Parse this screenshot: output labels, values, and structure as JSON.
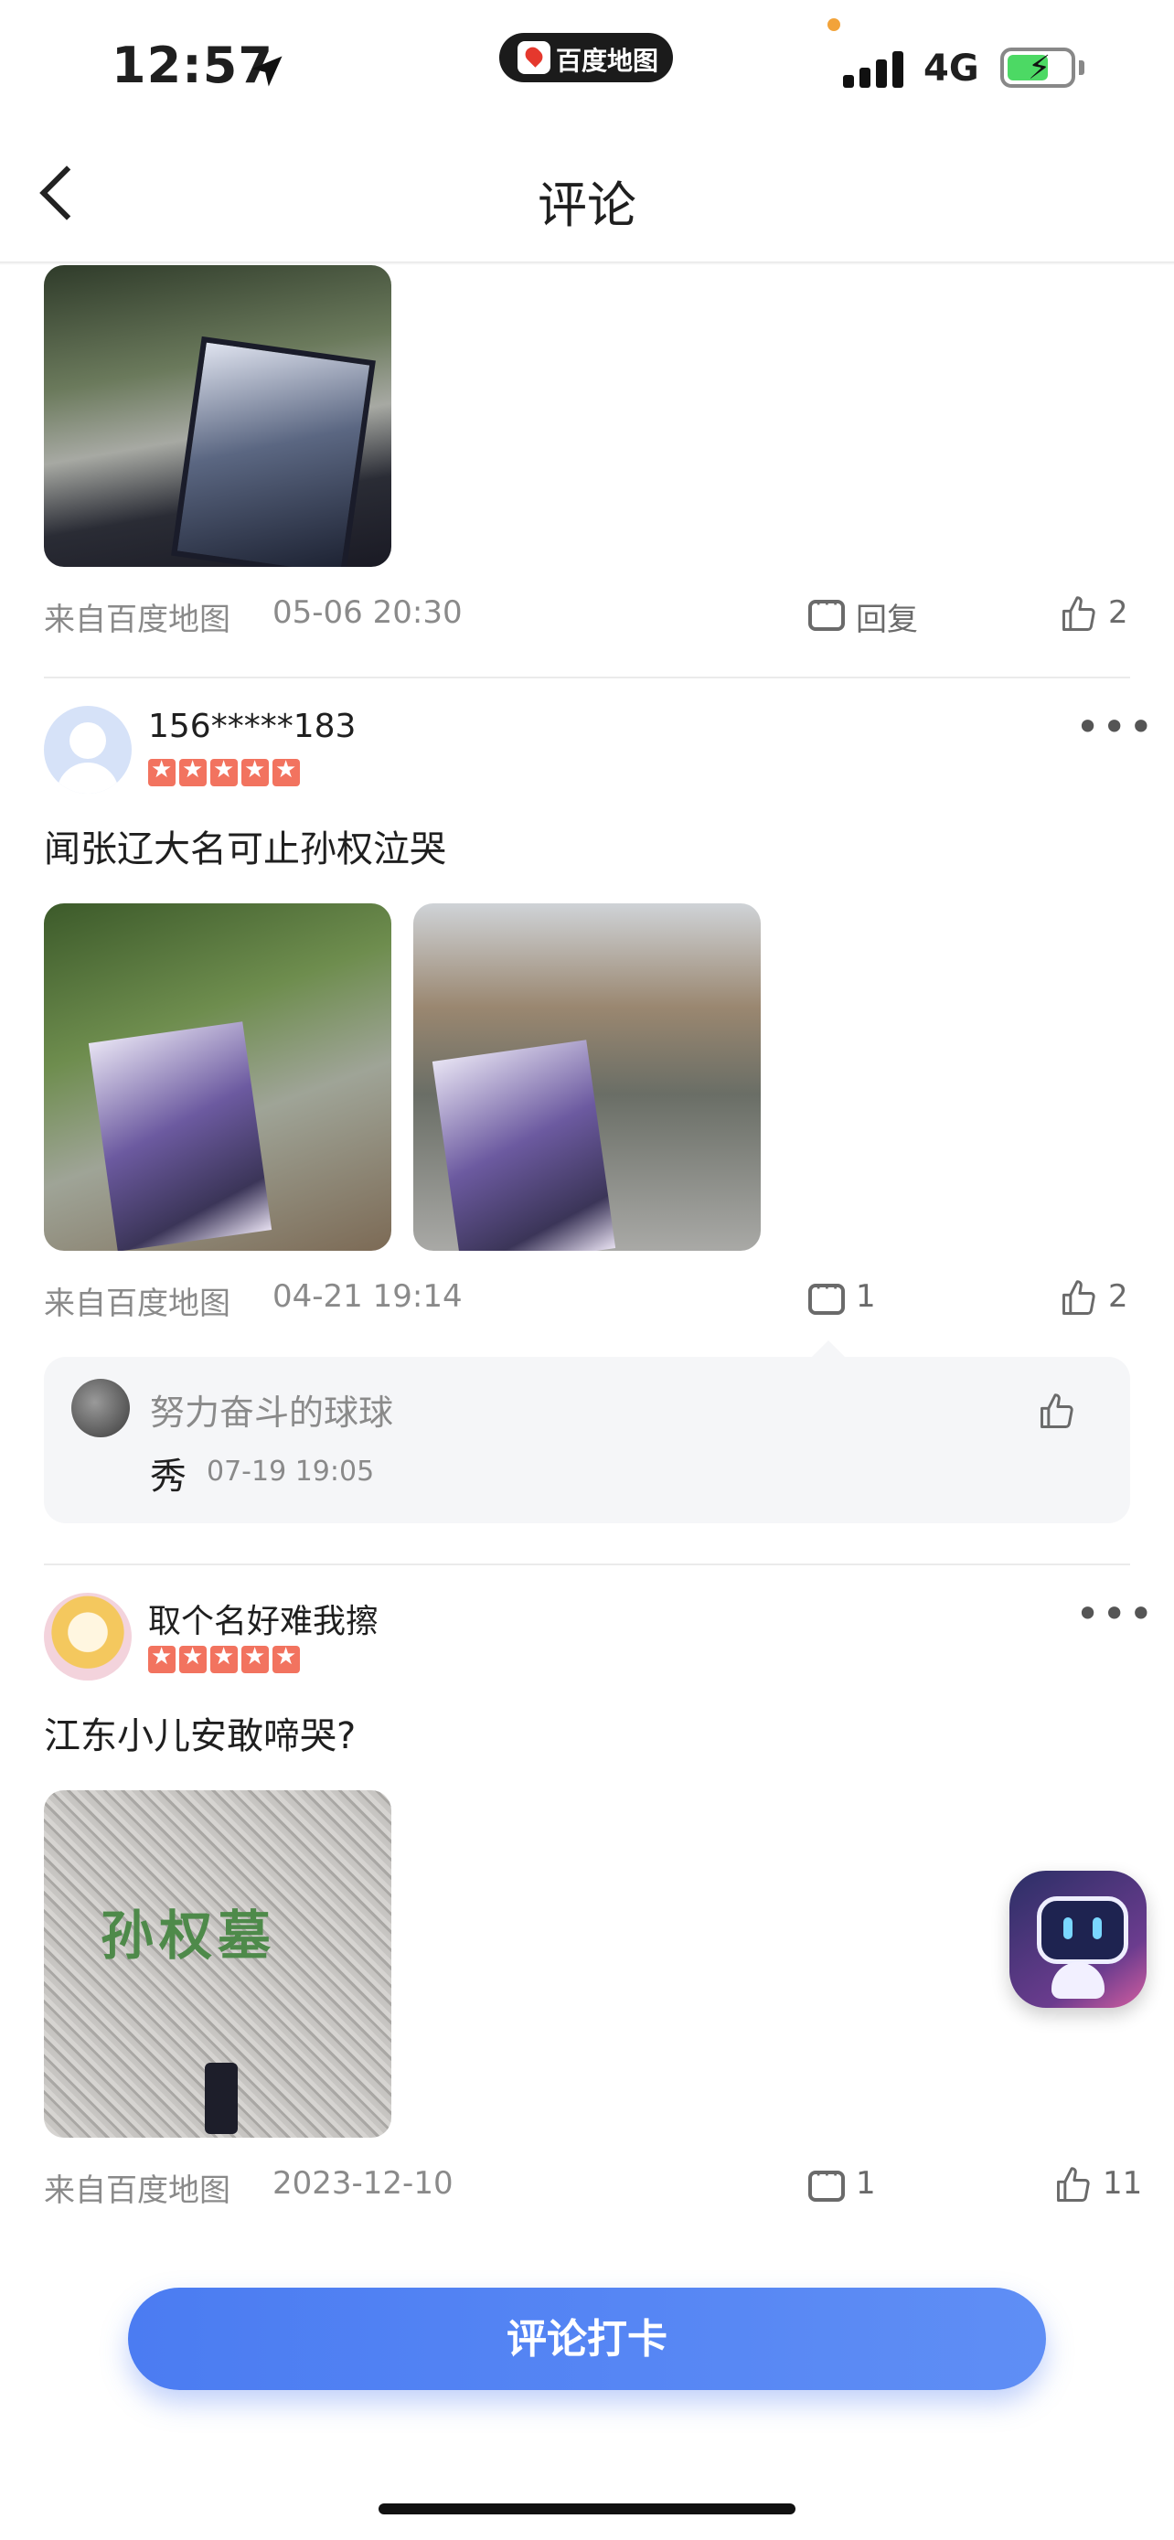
{
  "status_bar": {
    "time": "12:57",
    "app_badge": "百度地图",
    "network": "4G"
  },
  "nav": {
    "title": "评论"
  },
  "top_review": {
    "source": "来自百度地图",
    "time": "05-06 20:30",
    "reply_label": "回复",
    "likes": "2"
  },
  "review1": {
    "user": "156*****183",
    "rating": 5,
    "text": "闻张辽大名可止孙权泣哭",
    "source": "来自百度地图",
    "time": "04-21 19:14",
    "comments": "1",
    "likes": "2",
    "reply": {
      "user": "努力奋斗的球球",
      "text": "秀",
      "time": "07-19 19:05"
    }
  },
  "review2": {
    "user": "取个名好难我擦",
    "rating": 5,
    "text": "江东小儿安敢啼哭?",
    "photo_text": "孙权墓",
    "source": "来自百度地图",
    "time": "2023-12-10",
    "comments": "1",
    "likes": "11"
  },
  "cta": {
    "label": "评论打卡"
  },
  "colors": {
    "accent": "#4b7cf2",
    "star": "#f2735f",
    "battery": "#4cd964"
  }
}
